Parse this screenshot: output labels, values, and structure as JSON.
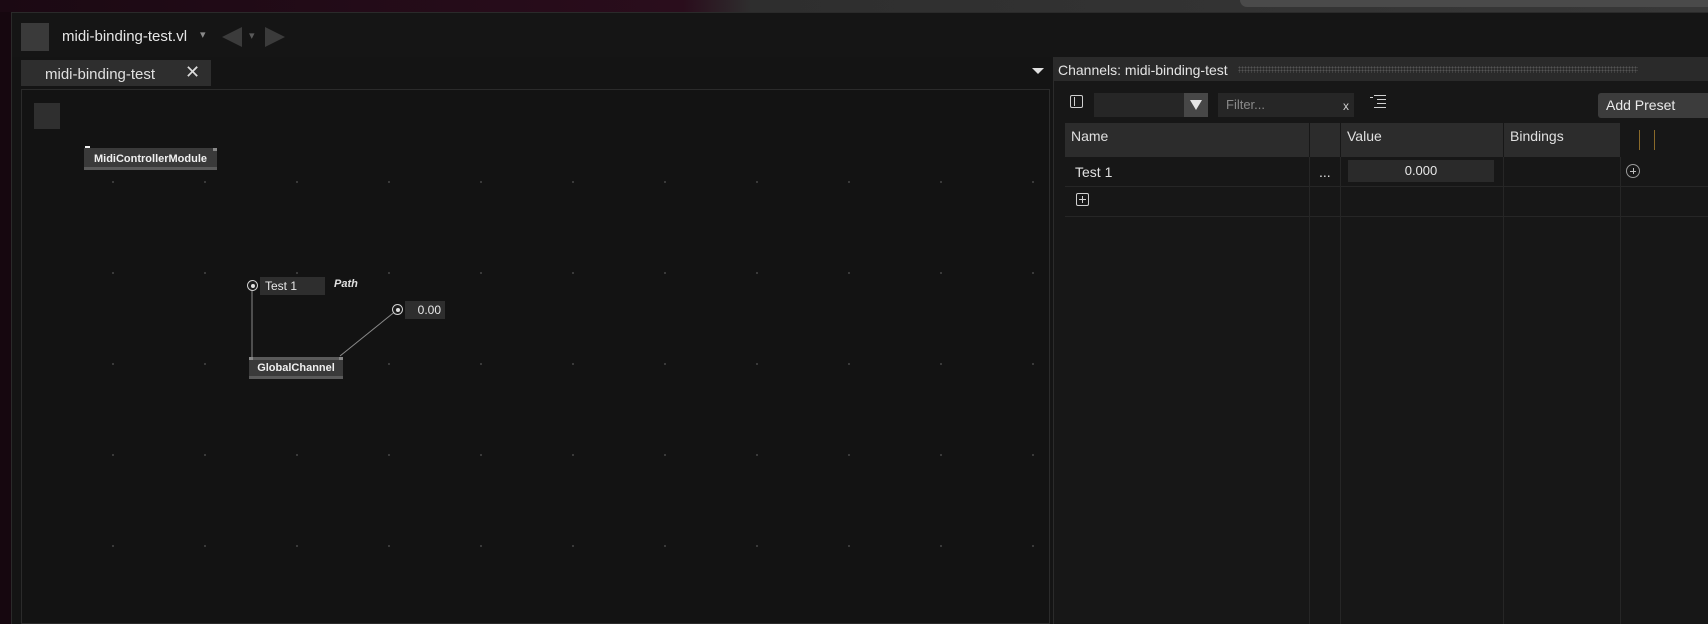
{
  "window": {
    "document_title": "midi-binding-test.vl"
  },
  "editor": {
    "tab_label": "midi-binding-test",
    "tab_close": "✕",
    "nodes": {
      "midi_controller_module": "MidiControllerModule",
      "global_channel": "GlobalChannel"
    },
    "iobox_name": "Test 1",
    "iobox_value": "0.00",
    "path_label": "Path"
  },
  "channels_panel": {
    "title": "Channels: midi-binding-test",
    "filter_placeholder": "Filter...",
    "filter_clear": "x",
    "add_preset_label": "Add Preset",
    "columns": [
      "Name",
      "Value",
      "Bindings"
    ],
    "rows": [
      {
        "name": "Test 1",
        "more": "...",
        "value": "0.000",
        "bindings": ""
      }
    ]
  },
  "colors": {
    "background": "#141414",
    "panel_header": "#2a2a2a",
    "node": "#3a3a3a",
    "accent_amber": "#8a6a2a"
  },
  "icons": {
    "nav_back": "triangle-left-icon",
    "nav_forward": "triangle-right-icon",
    "sidebar_toggle": "sidebar-icon",
    "preset_dropdown": "triangle-down-icon",
    "list_indent": "list-indent-icon",
    "add_row": "plus-square-icon",
    "add_binding": "plus-circle-icon"
  }
}
